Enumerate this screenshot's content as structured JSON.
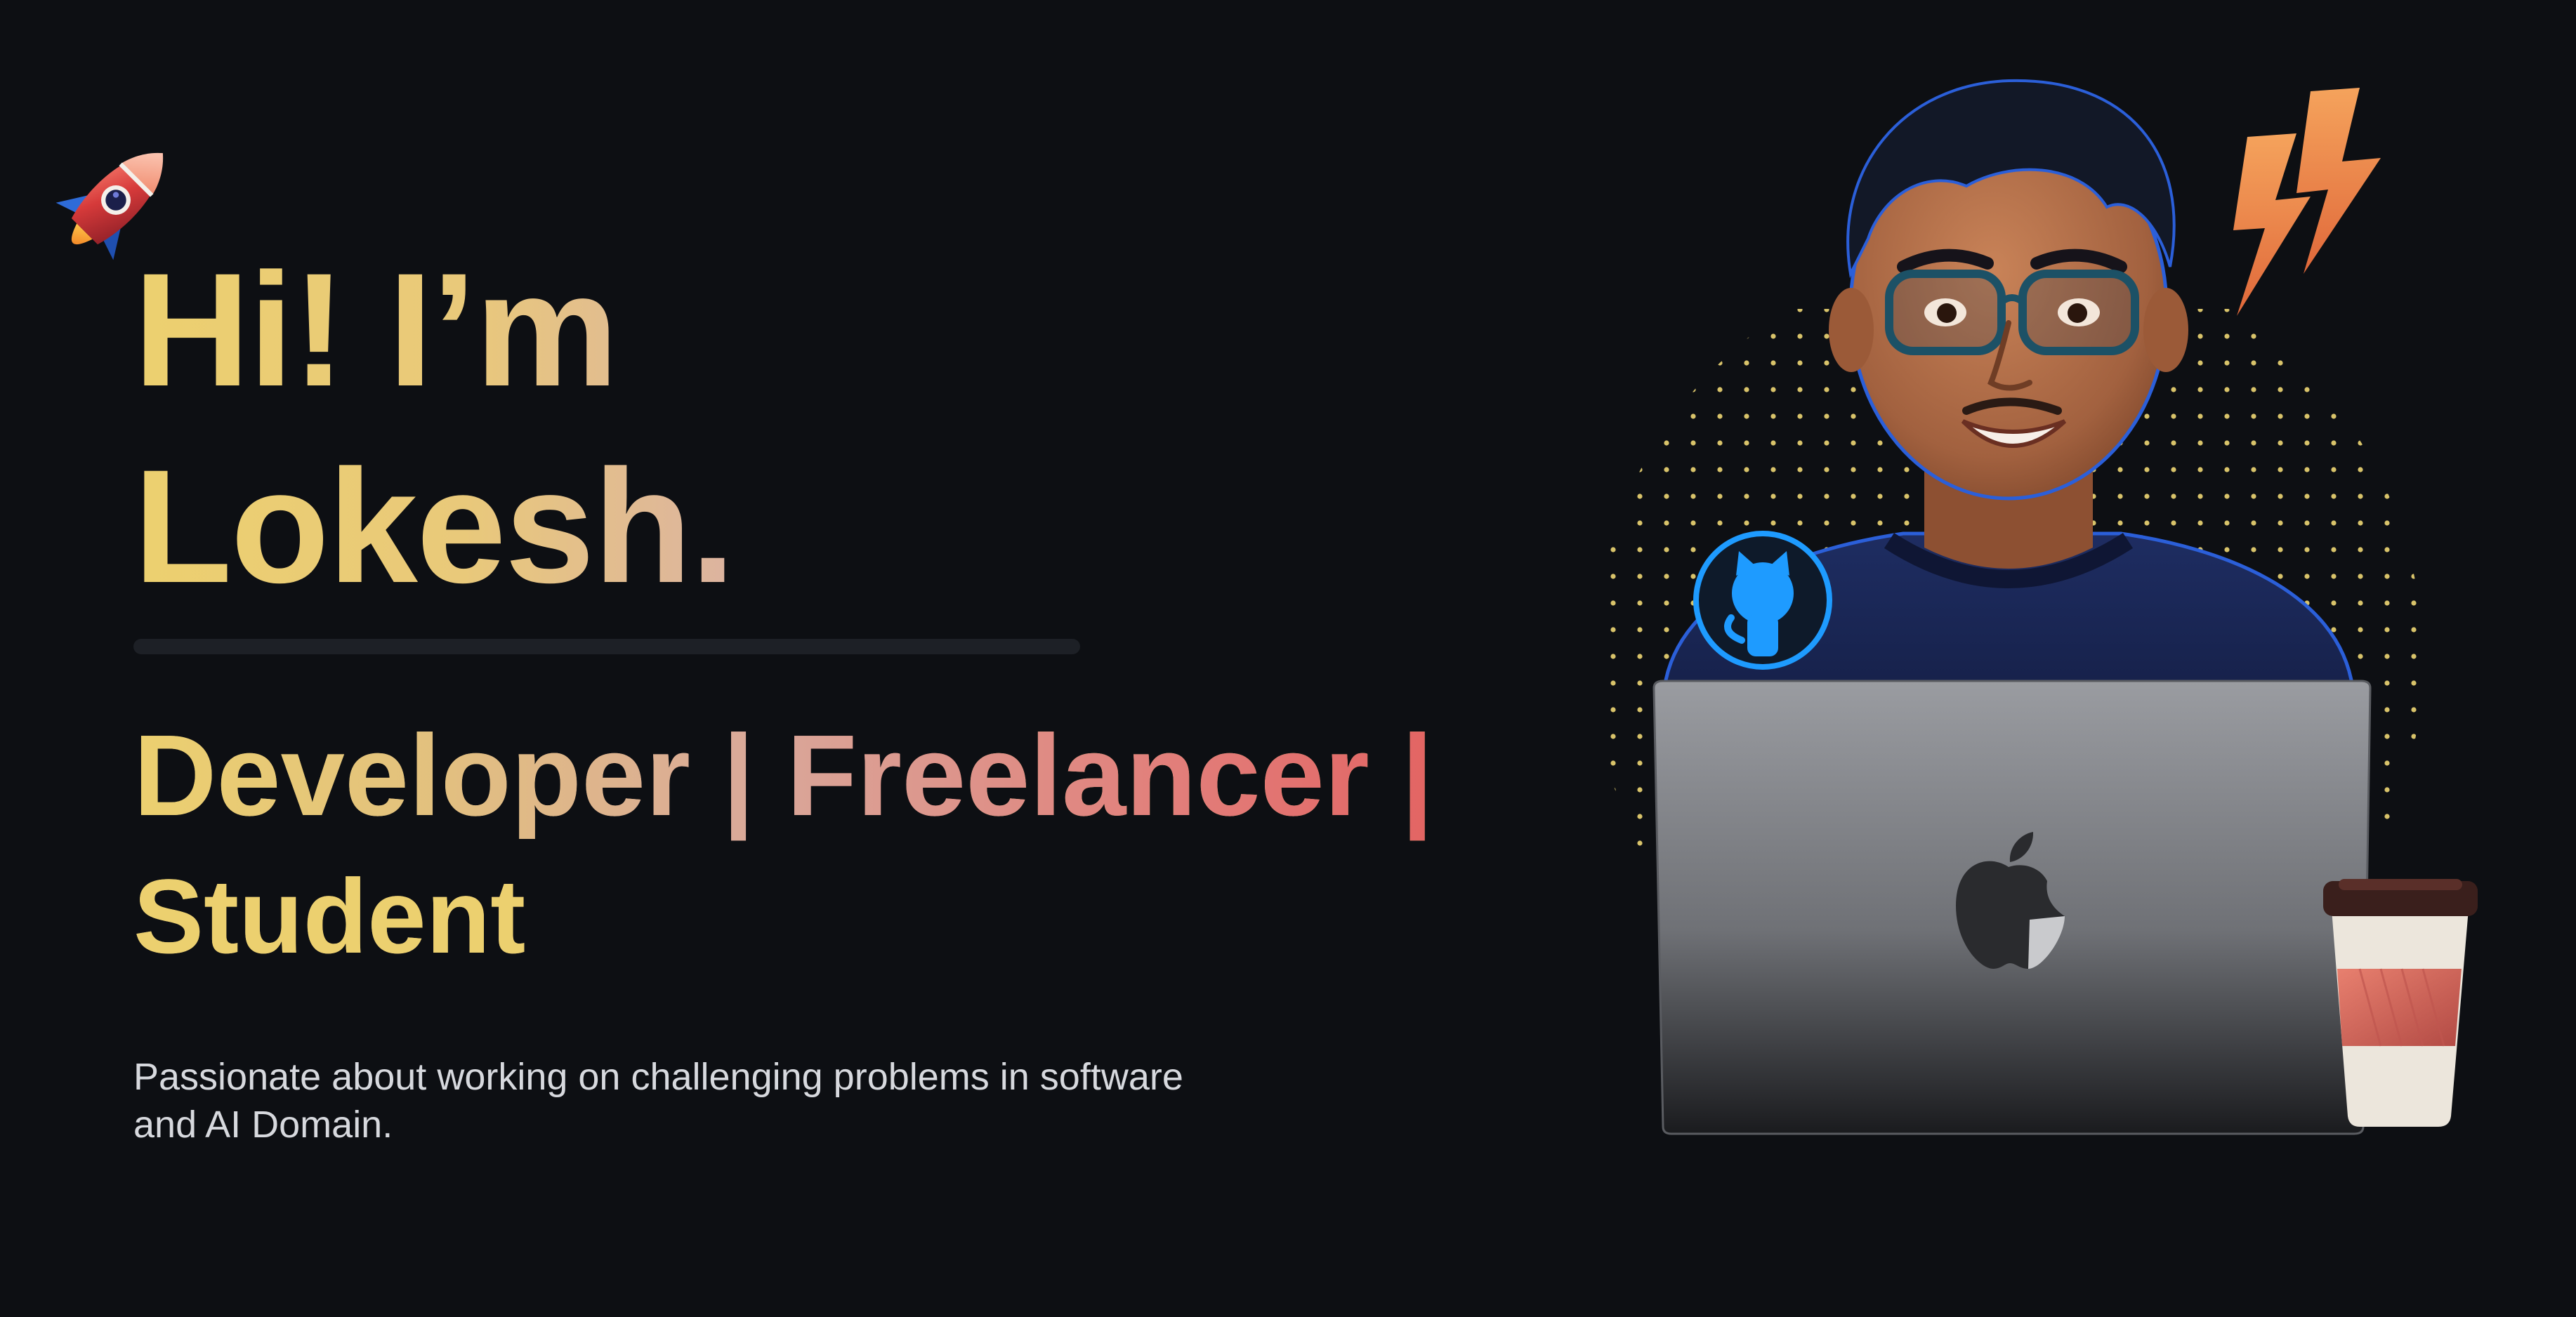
{
  "hero": {
    "greeting_line1": "Hi! I’m",
    "greeting_line2": "Lokesh.",
    "roles_line1": "Developer | Freelancer |",
    "roles_line2": "Student",
    "bio": "Passionate about working on challenging problems in software and AI Domain."
  },
  "icons": {
    "rocket": "rocket-icon",
    "lightning": "lightning-bolt-icon",
    "github": "github-octocat-icon",
    "apple": "apple-logo-icon",
    "coffee": "coffee-cup-icon"
  },
  "colors": {
    "background": "#0d0f13",
    "accent_yellow": "#ecd06f",
    "accent_red": "#e35b5b",
    "bio_text": "#d7d9de",
    "github_blue": "#1e9bff"
  }
}
